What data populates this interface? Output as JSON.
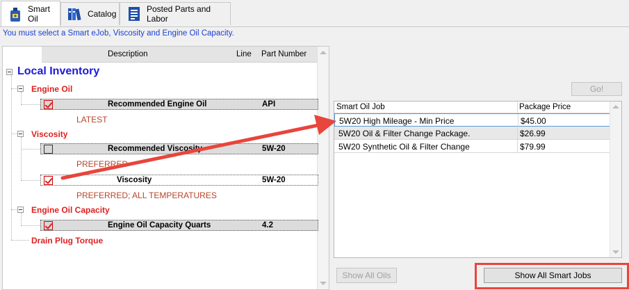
{
  "tabs": [
    {
      "label": "Smart Oil",
      "icon": "oil-bottle-icon"
    },
    {
      "label": "Catalog",
      "icon": "catalog-books-icon"
    },
    {
      "label": "Posted Parts and Labor",
      "icon": "document-list-icon"
    }
  ],
  "notice": "You must select a Smart eJob, Viscosity and Engine Oil Capacity.",
  "grid_header": {
    "description": "Description",
    "line": "Line",
    "part_number": "Part Number"
  },
  "tree": {
    "root": "Local Inventory",
    "groups": [
      {
        "label": "Engine Oil",
        "rows": [
          {
            "description": "Recommended Engine Oil",
            "part": "API",
            "checked": true,
            "note": "LATEST"
          }
        ]
      },
      {
        "label": "Viscosity",
        "rows": [
          {
            "description": "Recommended Viscosity",
            "part": "5W-20",
            "checked": false,
            "note": "PREFERRED"
          },
          {
            "description": "Viscosity",
            "part": "5W-20",
            "checked": true,
            "note": "PREFERRED; ALL TEMPERATURES"
          }
        ]
      },
      {
        "label": "Engine Oil Capacity",
        "rows": [
          {
            "description": "Engine Oil Capacity Quarts",
            "part": "4.2",
            "checked": true
          }
        ]
      },
      {
        "label": "Drain Plug Torque"
      }
    ]
  },
  "go_button": "Go!",
  "jobs_table": {
    "headers": {
      "job": "Smart Oil Job",
      "price": "Package Price"
    },
    "rows": [
      {
        "job": "5W20 High Mileage - Min Price",
        "price": "$45.00"
      },
      {
        "job": "5W20 Oil & Filter Change Package.",
        "price": "$26.99"
      },
      {
        "job": "5W20 Synthetic Oil & Filter Change",
        "price": "$79.99"
      }
    ]
  },
  "buttons": {
    "show_all_oils": "Show All Oils",
    "show_all_smart_jobs": "Show All Smart Jobs"
  },
  "colors": {
    "annotation_red": "#e8453c",
    "notice_blue": "#1a3fd3",
    "group_red": "#e02020",
    "root_blue": "#1a1adb"
  }
}
